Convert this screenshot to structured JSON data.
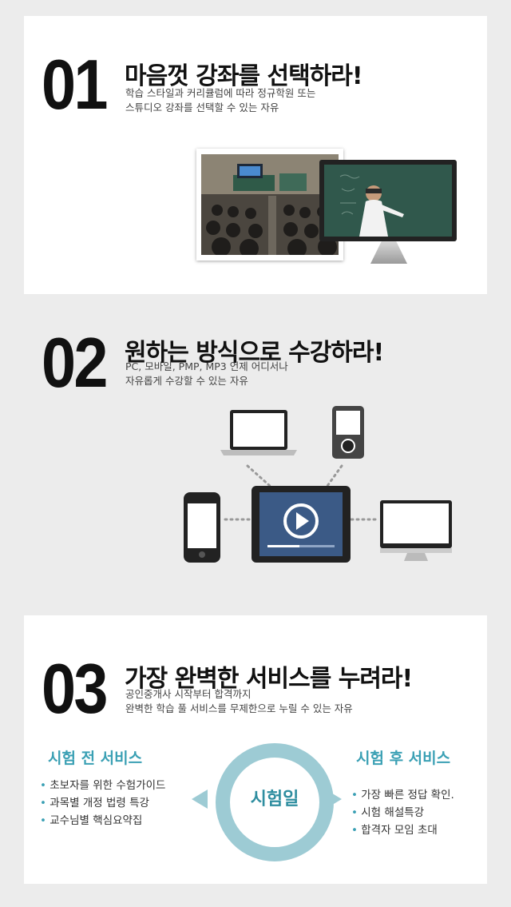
{
  "sections": [
    {
      "number": "01",
      "title": "마음껏 강좌를 선택하라!",
      "sub1": "학습 스타일과 커리큘럼에 따라 정규학원 또는",
      "sub2": "스튜디오 강좌를 선택할 수 있는 자유"
    },
    {
      "number": "02",
      "title": "원하는 방식으로 수강하라!",
      "sub1": "PC, 모바일, PMP, MP3 언제 어디서나",
      "sub2": "자유롭게 수강할 수 있는 자유"
    },
    {
      "number": "03",
      "title": "가장 완벽한 서비스를 누려라!",
      "sub1": "공인중개사 시작부터 합격까지",
      "sub2": "완벽한 학습 풀 서비스를 무제한으로 누릴 수 있는 자유"
    }
  ],
  "services": {
    "before_title": "시험 전 서비스",
    "before": [
      "초보자를 위한 수험가이드",
      "과목별 개정 법령 특강",
      "교수님별 핵심요약집"
    ],
    "center": "시험일",
    "after_title": "시험 후 서비스",
    "after": [
      "가장 빠른 정답 확인.",
      "시험 해설특강",
      "합격자 모임 초대"
    ]
  },
  "colors": {
    "accent": "#3aa0b4",
    "ring": "#9dcbd4",
    "device_screen": "#3b5a86",
    "board": "#30584c"
  },
  "icons": [
    "laptop-icon",
    "mp3-player-icon",
    "smartphone-icon",
    "tablet-icon",
    "play-icon",
    "desktop-monitor-icon"
  ]
}
